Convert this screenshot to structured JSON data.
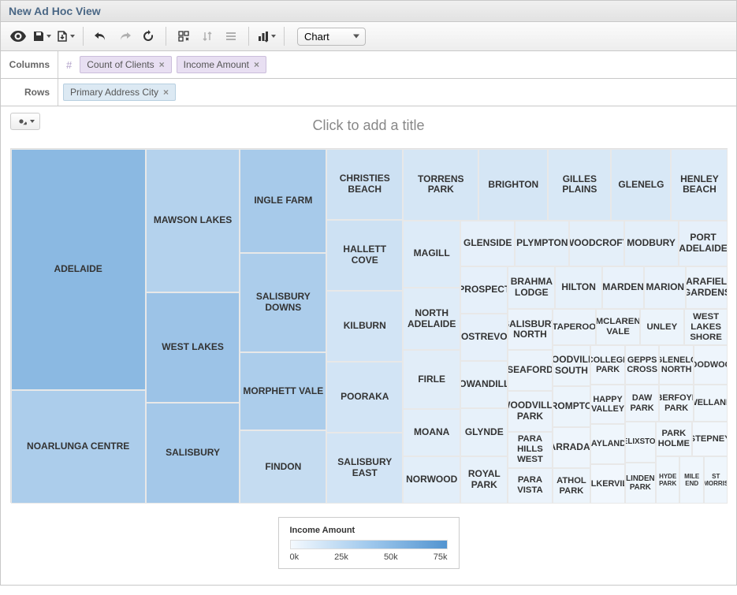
{
  "header": {
    "title": "New Ad Hoc View"
  },
  "toolbar": {
    "view_mode_label": "Chart",
    "view_mode_options": [
      "Chart",
      "Table",
      "Crosstab"
    ]
  },
  "pills": {
    "columns_label": "Columns",
    "rows_label": "Rows",
    "columns": [
      "Count of Clients",
      "Income Amount"
    ],
    "rows": [
      "Primary Address City"
    ]
  },
  "chart_title_placeholder": "Click to add a title",
  "legend": {
    "title": "Income Amount",
    "ticks": [
      "0k",
      "25k",
      "50k",
      "75k"
    ]
  },
  "chart_data": {
    "type": "treemap",
    "title": "",
    "size_measure": "Count of Clients",
    "color_measure": "Income Amount",
    "color_range": [
      0,
      75000
    ],
    "categories_field": "Primary Address City",
    "items": [
      {
        "name": "ADELAIDE",
        "count": 720,
        "income": 65000
      },
      {
        "name": "NOARLUNGA CENTRE",
        "count": 340,
        "income": 45000
      },
      {
        "name": "MAWSON LAKES",
        "count": 300,
        "income": 40000
      },
      {
        "name": "WEST LAKES",
        "count": 230,
        "income": 55000
      },
      {
        "name": "SALISBURY",
        "count": 210,
        "income": 50000
      },
      {
        "name": "INGLE FARM",
        "count": 200,
        "income": 48000
      },
      {
        "name": "SALISBURY DOWNS",
        "count": 190,
        "income": 45000
      },
      {
        "name": "MORPHETT VALE",
        "count": 150,
        "income": 45000
      },
      {
        "name": "FINDON",
        "count": 140,
        "income": 30000
      },
      {
        "name": "CHRISTIES BEACH",
        "count": 120,
        "income": 25000
      },
      {
        "name": "HALLETT COVE",
        "count": 120,
        "income": 25000
      },
      {
        "name": "KILBURN",
        "count": 120,
        "income": 22000
      },
      {
        "name": "POORAKA",
        "count": 120,
        "income": 22000
      },
      {
        "name": "SALISBURY EAST",
        "count": 120,
        "income": 22000
      },
      {
        "name": "TORRENS PARK",
        "count": 120,
        "income": 20000
      },
      {
        "name": "BRIGHTON",
        "count": 110,
        "income": 20000
      },
      {
        "name": "GILLES PLAINS",
        "count": 100,
        "income": 18000
      },
      {
        "name": "GLENELG",
        "count": 95,
        "income": 18000
      },
      {
        "name": "HENLEY BEACH",
        "count": 90,
        "income": 15000
      },
      {
        "name": "MAGILL",
        "count": 85,
        "income": 15000
      },
      {
        "name": "NORTH ADELAIDE",
        "count": 80,
        "income": 14000
      },
      {
        "name": "FIRLE",
        "count": 75,
        "income": 13000
      },
      {
        "name": "GLENSIDE",
        "count": 55,
        "income": 10000
      },
      {
        "name": "MOANA",
        "count": 60,
        "income": 12000
      },
      {
        "name": "NORWOOD",
        "count": 60,
        "income": 12000
      },
      {
        "name": "PLYMPTON",
        "count": 55,
        "income": 11000
      },
      {
        "name": "WOODCROFT",
        "count": 55,
        "income": 11000
      },
      {
        "name": "MODBURY",
        "count": 55,
        "income": 11000
      },
      {
        "name": "PORT ADELAIDE",
        "count": 50,
        "income": 10000
      },
      {
        "name": "PROSPECT",
        "count": 50,
        "income": 10000
      },
      {
        "name": "ROSTREVOR",
        "count": 50,
        "income": 10000
      },
      {
        "name": "BRAHMA LODGE",
        "count": 45,
        "income": 9000
      },
      {
        "name": "COWANDILLA",
        "count": 50,
        "income": 9000
      },
      {
        "name": "GLYNDE",
        "count": 50,
        "income": 9000
      },
      {
        "name": "HILTON",
        "count": 45,
        "income": 9000
      },
      {
        "name": "MARDEN",
        "count": 40,
        "income": 8000
      },
      {
        "name": "ROYAL PARK",
        "count": 50,
        "income": 9000
      },
      {
        "name": "MARION",
        "count": 40,
        "income": 8000
      },
      {
        "name": "PARA HILLS WEST",
        "count": 35,
        "income": 7000
      },
      {
        "name": "PARA VISTA",
        "count": 35,
        "income": 7000
      },
      {
        "name": "PARAFIELD GARDENS",
        "count": 40,
        "income": 7000
      },
      {
        "name": "SALISBURY NORTH",
        "count": 40,
        "income": 7000
      },
      {
        "name": "SEAFORD",
        "count": 40,
        "income": 7000
      },
      {
        "name": "TAPEROO",
        "count": 35,
        "income": 7000
      },
      {
        "name": "WOODVILLE PARK",
        "count": 40,
        "income": 7000
      },
      {
        "name": "MCLAREN VALE",
        "count": 35,
        "income": 6000
      },
      {
        "name": "UNLEY",
        "count": 35,
        "income": 6000
      },
      {
        "name": "WEST LAKES SHORE",
        "count": 35,
        "income": 6000
      },
      {
        "name": "WOODVILLE SOUTH",
        "count": 35,
        "income": 6000
      },
      {
        "name": "ATHOL PARK",
        "count": 30,
        "income": 6000
      },
      {
        "name": "BROMPTON",
        "count": 35,
        "income": 6000
      },
      {
        "name": "COLLEGE PARK",
        "count": 30,
        "income": 5000
      },
      {
        "name": "DAW PARK",
        "count": 28,
        "income": 5000
      },
      {
        "name": "WARRADALE",
        "count": 35,
        "income": 5000
      },
      {
        "name": "GEPPS CROSS",
        "count": 30,
        "income": 5000
      },
      {
        "name": "GLENELG NORTH",
        "count": 30,
        "income": 5000
      },
      {
        "name": "GOODWOOD",
        "count": 30,
        "income": 5000
      },
      {
        "name": "HAPPY VALLEY",
        "count": 30,
        "income": 5000
      },
      {
        "name": "HYDE PARK",
        "count": 25,
        "income": 4000
      },
      {
        "name": "ABERFOYLE PARK",
        "count": 28,
        "income": 4000
      },
      {
        "name": "MILE END",
        "count": 25,
        "income": 4000
      },
      {
        "name": "WELLAND",
        "count": 28,
        "income": 4000
      },
      {
        "name": "FELIXSTOW",
        "count": 28,
        "income": 4000
      },
      {
        "name": "LINDEN PARK",
        "count": 28,
        "income": 4000
      },
      {
        "name": "MAYLANDS",
        "count": 30,
        "income": 4000
      },
      {
        "name": "PARK HOLME",
        "count": 28,
        "income": 4000
      },
      {
        "name": "ST MORRIS",
        "count": 25,
        "income": 4000
      },
      {
        "name": "STEPNEY",
        "count": 28,
        "income": 3000
      },
      {
        "name": "WALKERVILLE",
        "count": 30,
        "income": 3000
      }
    ]
  }
}
